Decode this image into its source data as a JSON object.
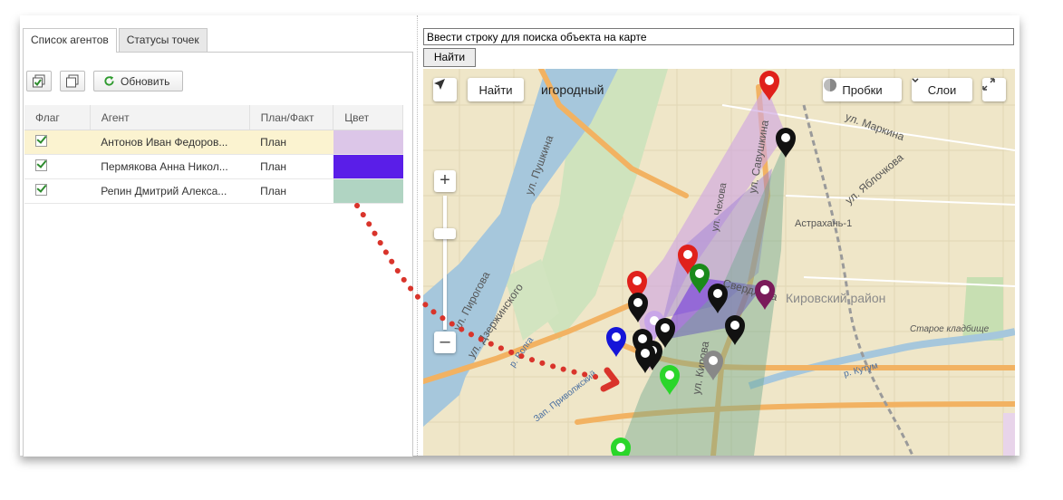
{
  "tabs": [
    {
      "label": "Список агентов"
    },
    {
      "label": "Статусы точек"
    }
  ],
  "toolbar": {
    "refresh_label": "Обновить"
  },
  "table": {
    "headers": [
      "Флаг",
      "Агент",
      "План/Факт",
      "Цвет"
    ],
    "rows": [
      {
        "agent": "Антонов Иван Федоров...",
        "plan": "План",
        "color": "#dcc6e8"
      },
      {
        "agent": "Пермякова Анна Никол...",
        "plan": "План",
        "color": "#5a1ee8"
      },
      {
        "agent": "Репин Дмитрий Алекса...",
        "plan": "План",
        "color": "#b0d4c2"
      }
    ]
  },
  "search": {
    "value": "Ввести строку для поиска объекта на карте",
    "button": "Найти"
  },
  "map": {
    "find_label": "Найти",
    "traffic_label": "Пробки",
    "layers_label": "Слои",
    "labels": {
      "district_top": "игородный",
      "pushkina": "ул. Пушкина",
      "chekhova": "ул. Чехова",
      "savushkina": "ул. Савушкина",
      "markina": "ул. Маркина",
      "yablochkova": "ул. Яблочкова",
      "station": "Астрахань-1",
      "kirovsky": "Кировский район",
      "pirogova": "ул. Пирогова",
      "dzerzhinsky": "ул. Дзержинского",
      "volga": "р. Волга",
      "sverdlova": "Свердлова",
      "cemetery": "Старое кладбище",
      "kutum": "р. Кутум",
      "kirova": "ул. Кирова",
      "embankment": "Зап. Приволжский"
    }
  },
  "colors": {
    "pin_red": "#e0211b",
    "pin_black": "#111111",
    "pin_green": "#1a8a1a",
    "pin_lightgreen": "#2ad62a",
    "pin_blue": "#1515d8",
    "pin_purple": "#7a1a5a",
    "pin_lilac": "#c9a6e8",
    "pin_gray": "#888888",
    "arrow": "#d9342b"
  }
}
